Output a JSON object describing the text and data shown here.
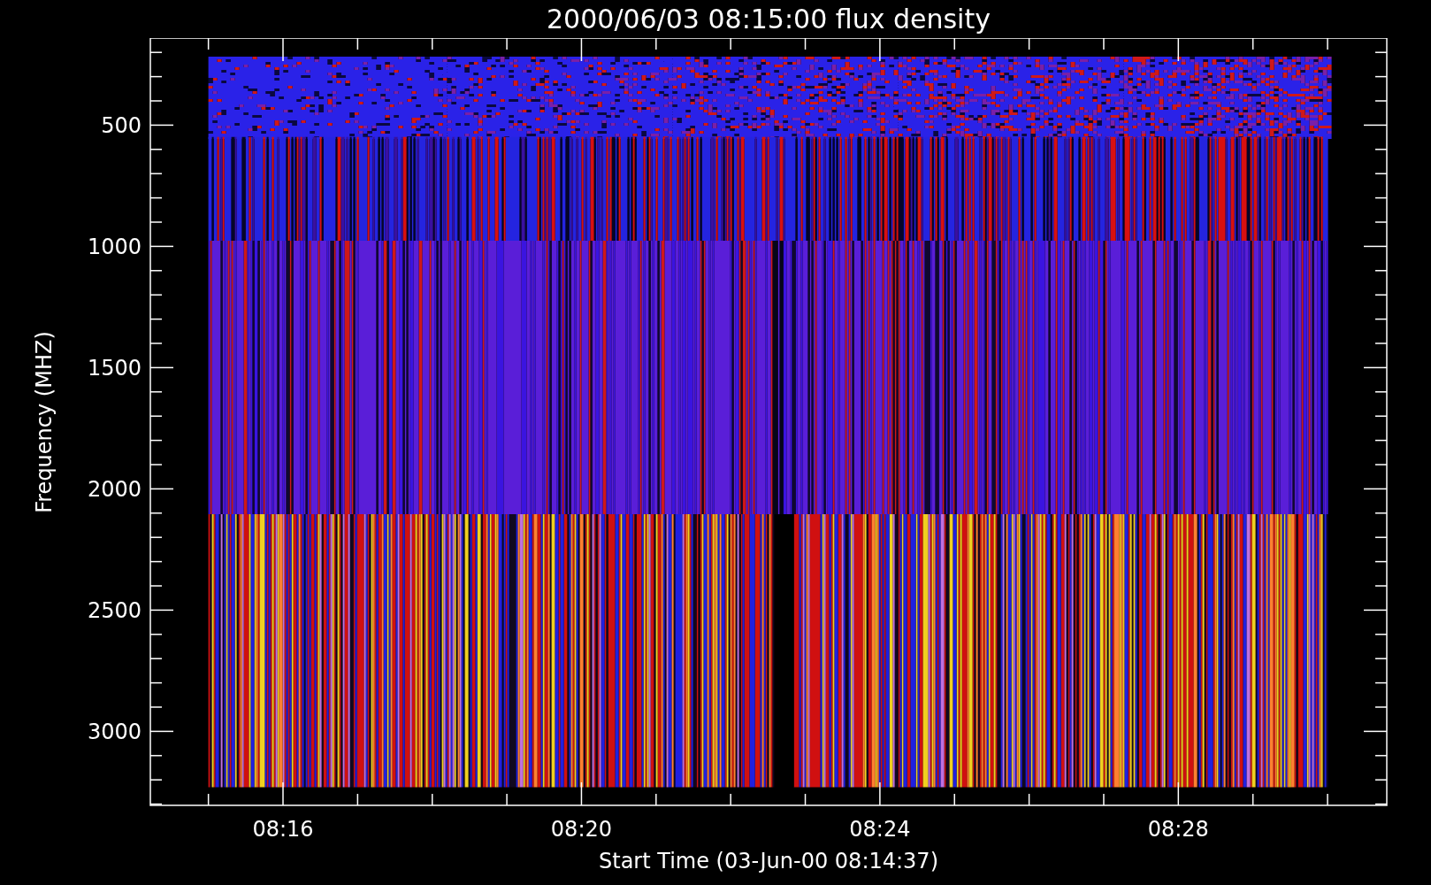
{
  "title": "2000/06/03 08:15:00 flux density",
  "y_axis": {
    "label": "Frequency (MHZ)",
    "ticks": [
      "500",
      "1000",
      "1500",
      "2000",
      "2500",
      "3000"
    ]
  },
  "x_axis": {
    "label": "Start Time (03-Jun-00 08:14:37)",
    "ticks": [
      "08:16",
      "08:20",
      "08:24",
      "08:28"
    ]
  }
}
